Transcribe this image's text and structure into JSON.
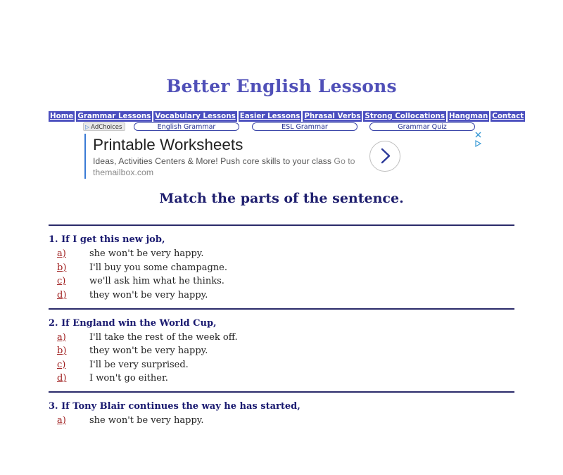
{
  "site": {
    "title": "Better English Lessons"
  },
  "nav": {
    "items": [
      {
        "label": "Home"
      },
      {
        "label": "Grammar Lessons"
      },
      {
        "label": "Vocabulary Lessons"
      },
      {
        "label": "Easier Lessons"
      },
      {
        "label": "Phrasal Verbs"
      },
      {
        "label": "Strong Collocations"
      },
      {
        "label": "Hangman"
      },
      {
        "label": "Contact"
      }
    ]
  },
  "adlinks": {
    "adchoices": "AdChoices",
    "links": [
      {
        "label": "English Grammar"
      },
      {
        "label": "ESL Grammar"
      },
      {
        "label": "Grammar Quiz"
      }
    ]
  },
  "ad": {
    "headline": "Printable Worksheets",
    "description": "Ideas, Activities Centers & More! Push core skills to your class",
    "goto": "Go to",
    "url": "themailbox.com",
    "arrow_icon": "chevron-right-icon",
    "accent": "#3a7bd5"
  },
  "page": {
    "heading": "Match the parts of the sentence."
  },
  "quiz": {
    "questions": [
      {
        "text": "1. If I get this new job,",
        "options": [
          {
            "letter": "a)",
            "text": "she won't be very happy."
          },
          {
            "letter": "b)",
            "text": "I'll buy you some champagne."
          },
          {
            "letter": "c)",
            "text": "we'll ask him what he thinks."
          },
          {
            "letter": "d)",
            "text": "they won't be very happy."
          }
        ]
      },
      {
        "text": "2. If England win the World Cup,",
        "options": [
          {
            "letter": "a)",
            "text": "I'll take the rest of the week off."
          },
          {
            "letter": "b)",
            "text": "they won't be very happy."
          },
          {
            "letter": "c)",
            "text": "I'll be very surprised."
          },
          {
            "letter": "d)",
            "text": "I won't go either."
          }
        ]
      },
      {
        "text": "3. If Tony Blair continues the way he has started,",
        "options": [
          {
            "letter": "a)",
            "text": "she won't be very happy."
          }
        ]
      }
    ]
  },
  "colors": {
    "title": "#5050b8",
    "nav_bg": "#4b4fbf",
    "heading": "#1e1e6e",
    "option_letter": "#a02020"
  }
}
